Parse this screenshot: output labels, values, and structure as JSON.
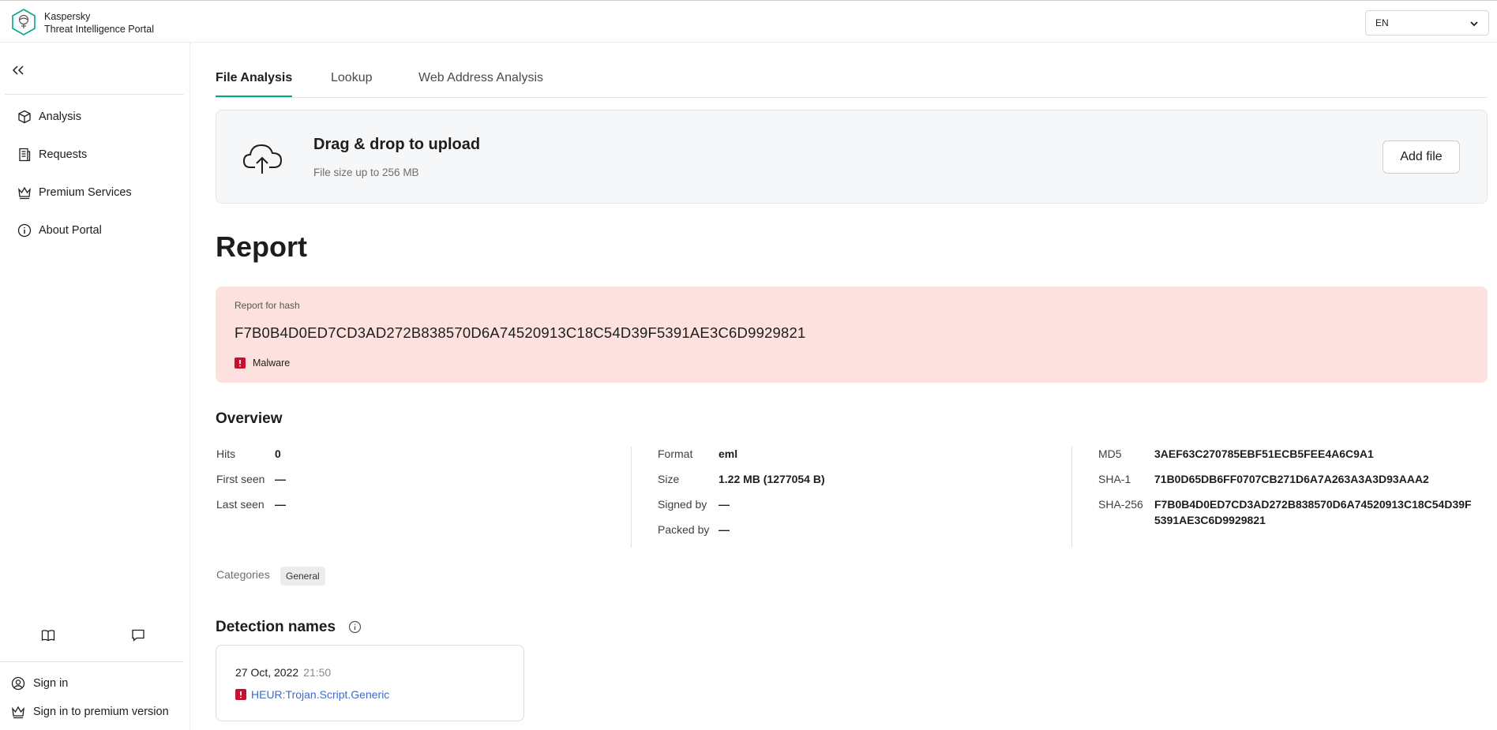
{
  "brand": {
    "line1": "Kaspersky",
    "line2": "Threat Intelligence Portal"
  },
  "language": {
    "selected": "EN"
  },
  "sidebar": {
    "items": [
      {
        "label": "Analysis",
        "icon": "cube-icon"
      },
      {
        "label": "Requests",
        "icon": "document-icon"
      },
      {
        "label": "Premium Services",
        "icon": "crown-icon"
      },
      {
        "label": "About Portal",
        "icon": "info-icon"
      }
    ],
    "bottom_icons": [
      "book-icon",
      "chat-icon"
    ],
    "sign_in": "Sign in",
    "sign_in_premium": "Sign in to premium version"
  },
  "tabs": [
    {
      "label": "File Analysis",
      "active": true
    },
    {
      "label": "Lookup",
      "active": false
    },
    {
      "label": "Web Address Analysis",
      "active": false
    }
  ],
  "upload": {
    "title": "Drag & drop to upload",
    "subtitle": "File size up to 256 MB",
    "button": "Add file"
  },
  "report": {
    "title": "Report",
    "hash_label": "Report for hash",
    "hash": "F7B0B4D0ED7CD3AD272B838570D6A74520913C18C54D39F5391AE3C6D9929821",
    "verdict": "Malware"
  },
  "overview": {
    "title": "Overview",
    "hits_label": "Hits",
    "hits": "0",
    "first_seen_label": "First seen",
    "first_seen": "—",
    "last_seen_label": "Last seen",
    "last_seen": "—",
    "format_label": "Format",
    "format": "eml",
    "size_label": "Size",
    "size": "1.22 MB (1277054 B)",
    "signed_by_label": "Signed by",
    "signed_by": "—",
    "packed_by_label": "Packed by",
    "packed_by": "—",
    "md5_label": "MD5",
    "md5": "3AEF63C270785EBF51ECB5FEE4A6C9A1",
    "sha1_label": "SHA-1",
    "sha1": "71B0D65DB6FF0707CB271D6A7A263A3A3D93AAA2",
    "sha256_label": "SHA-256",
    "sha256_line1": "F7B0B4D0ED7CD3AD272B838570D6A74520913C18C54D39F",
    "sha256_line2": "5391AE3C6D9929821",
    "categories_label": "Categories",
    "category": "General"
  },
  "detection": {
    "title": "Detection names",
    "date": "27 Oct, 2022",
    "time": "21:50",
    "name": "HEUR:Trojan.Script.Generic"
  },
  "colors": {
    "accent": "#00a88e",
    "malware_bg": "#fde1df",
    "malware_icon": "#c8102e",
    "link": "#3f6bc9"
  }
}
